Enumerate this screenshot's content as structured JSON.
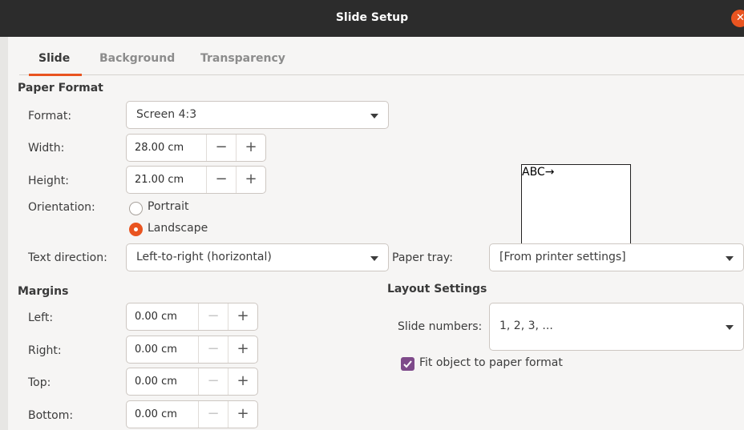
{
  "window": {
    "title": "Slide Setup",
    "close_icon": "close-icon"
  },
  "tabs": [
    {
      "label": "Slide",
      "active": true
    },
    {
      "label": "Background",
      "active": false
    },
    {
      "label": "Transparency",
      "active": false
    }
  ],
  "paper_format": {
    "heading": "Paper Format",
    "format_label": "Format:",
    "format_value": "Screen 4:3",
    "width_label": "Width:",
    "width_value": "28.00 cm",
    "height_label": "Height:",
    "height_value": "21.00 cm",
    "orientation_label": "Orientation:",
    "portrait_label": "Portrait",
    "landscape_label": "Landscape",
    "selected_orientation": "Landscape",
    "text_direction_label": "Text direction:",
    "text_direction_value": "Left-to-right (horizontal)",
    "paper_tray_label": "Paper tray:",
    "paper_tray_value": "[From printer settings]",
    "preview_text": "ABC→"
  },
  "spin_buttons": {
    "minus": "−",
    "plus": "+"
  },
  "margins": {
    "heading": "Margins",
    "left_label": "Left:",
    "left_value": "0.00 cm",
    "right_label": "Right:",
    "right_value": "0.00 cm",
    "top_label": "Top:",
    "top_value": "0.00 cm",
    "bottom_label": "Bottom:",
    "bottom_value": "0.00 cm"
  },
  "layout_settings": {
    "heading": "Layout Settings",
    "slide_numbers_label": "Slide numbers:",
    "slide_numbers_value": "1, 2, 3, ...",
    "fit_object_label": "Fit object to paper format",
    "fit_object_checked": true
  },
  "colors": {
    "accent": "#e95420",
    "checkbox": "#7e4a8a",
    "titlebar": "#2c2c2c"
  }
}
